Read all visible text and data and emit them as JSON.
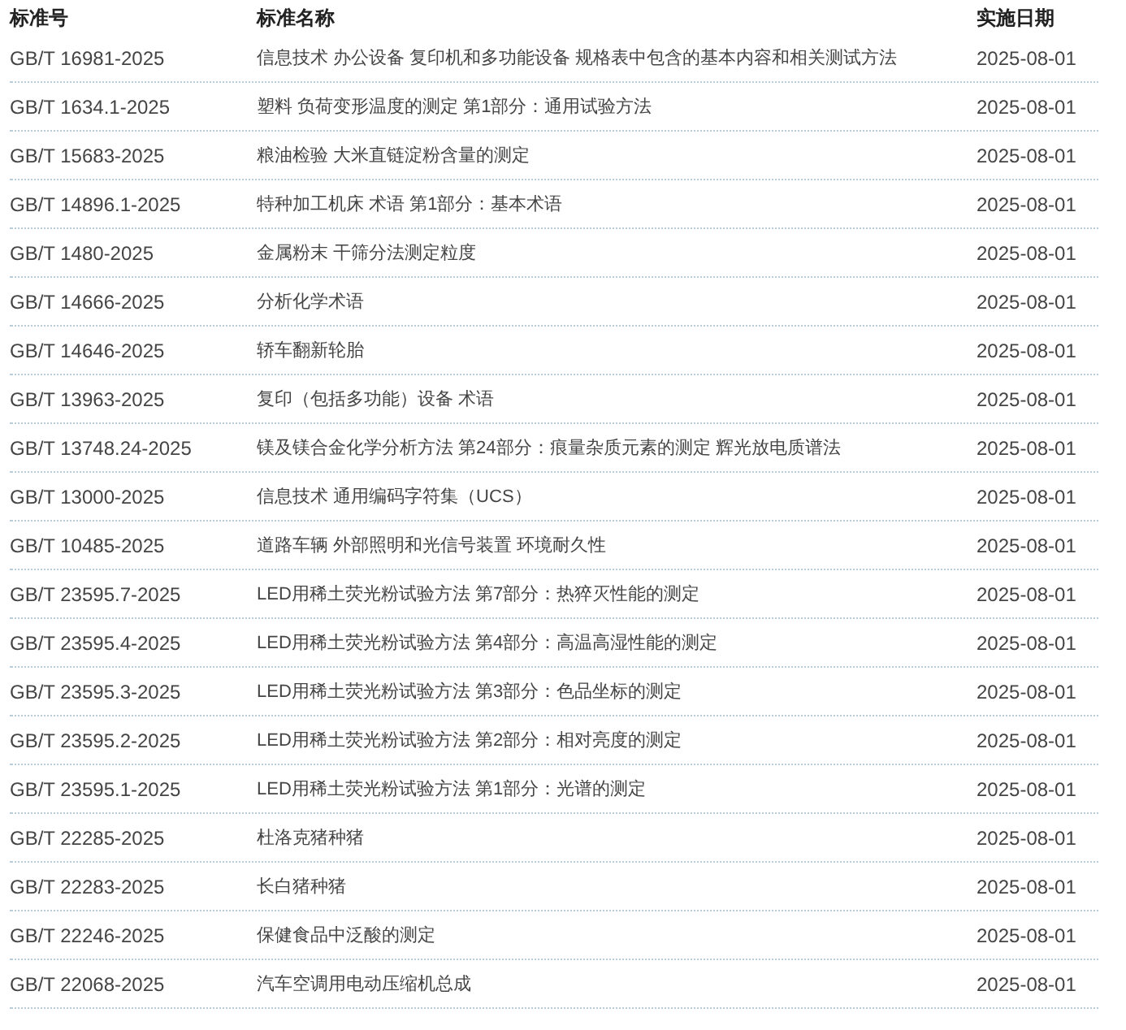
{
  "table": {
    "columns": [
      "标准号",
      "标准名称",
      "实施日期"
    ],
    "rows": [
      [
        "GB/T 16981-2025",
        "信息技术 办公设备 复印机和多功能设备 规格表中包含的基本内容和相关测试方法",
        "2025-08-01"
      ],
      [
        "GB/T 1634.1-2025",
        "塑料 负荷变形温度的测定 第1部分：通用试验方法",
        "2025-08-01"
      ],
      [
        "GB/T 15683-2025",
        "粮油检验 大米直链淀粉含量的测定",
        "2025-08-01"
      ],
      [
        "GB/T 14896.1-2025",
        "特种加工机床 术语 第1部分：基本术语",
        "2025-08-01"
      ],
      [
        "GB/T 1480-2025",
        "金属粉末 干筛分法测定粒度",
        "2025-08-01"
      ],
      [
        "GB/T 14666-2025",
        "分析化学术语",
        "2025-08-01"
      ],
      [
        "GB/T 14646-2025",
        "轿车翻新轮胎",
        "2025-08-01"
      ],
      [
        "GB/T 13963-2025",
        "复印（包括多功能）设备 术语",
        "2025-08-01"
      ],
      [
        "GB/T 13748.24-2025",
        "镁及镁合金化学分析方法 第24部分：痕量杂质元素的测定 辉光放电质谱法",
        "2025-08-01"
      ],
      [
        "GB/T 13000-2025",
        "信息技术 通用编码字符集（UCS）",
        "2025-08-01"
      ],
      [
        "GB/T 10485-2025",
        "道路车辆 外部照明和光信号装置 环境耐久性",
        "2025-08-01"
      ],
      [
        "GB/T 23595.7-2025",
        "LED用稀土荧光粉试验方法 第7部分：热猝灭性能的测定",
        "2025-08-01"
      ],
      [
        "GB/T 23595.4-2025",
        "LED用稀土荧光粉试验方法 第4部分：高温高湿性能的测定",
        "2025-08-01"
      ],
      [
        "GB/T 23595.3-2025",
        "LED用稀土荧光粉试验方法 第3部分：色品坐标的测定",
        "2025-08-01"
      ],
      [
        "GB/T 23595.2-2025",
        "LED用稀土荧光粉试验方法 第2部分：相对亮度的测定",
        "2025-08-01"
      ],
      [
        "GB/T 23595.1-2025",
        "LED用稀土荧光粉试验方法 第1部分：光谱的测定",
        "2025-08-01"
      ],
      [
        "GB/T 22285-2025",
        "杜洛克猪种猪",
        "2025-08-01"
      ],
      [
        "GB/T 22283-2025",
        "长白猪种猪",
        "2025-08-01"
      ],
      [
        "GB/T 22246-2025",
        "保健食品中泛酸的测定",
        "2025-08-01"
      ],
      [
        "GB/T 22068-2025",
        "汽车空调用电动压缩机总成",
        "2025-08-01"
      ]
    ]
  }
}
